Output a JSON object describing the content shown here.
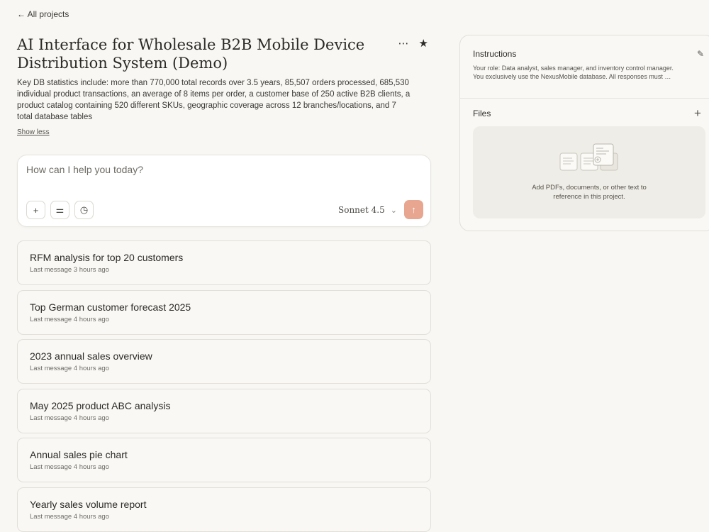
{
  "nav": {
    "back_label": "← All projects"
  },
  "project": {
    "title": "AI Interface for Wholesale B2B Mobile Device Distribution System (Demo)",
    "title_line1": "AI Interface for Wholesale B2B Mobile Device",
    "title_line2": "Distribution System (Demo)",
    "description_lines": [
      "Key DB statistics include: more than 770,000 total records over 3.5 years, 85,507 orders processed, 685,530",
      "individual product transactions, an average of 8 items per order, a customer base of 250 active B2B clients, a",
      "product catalog containing 520 different SKUs, geographic coverage across 12 branches/locations, and 7",
      "total database tables"
    ],
    "show_less_label": "Show less",
    "more_icon": "⋯",
    "star_icon": "★"
  },
  "composer": {
    "placeholder": "How can I help you today?",
    "add_icon": "+",
    "tools_icon": "⚌",
    "history_icon": "◷",
    "model": "Sonnet 4.5",
    "model_chevron": "⌄",
    "send_icon": "↑"
  },
  "chats": [
    {
      "title": "RFM analysis for top 20 customers",
      "meta": "Last message 3 hours ago"
    },
    {
      "title": "Top German customer forecast 2025",
      "meta": "Last message 4 hours ago"
    },
    {
      "title": "2023 annual sales overview",
      "meta": "Last message 4 hours ago"
    },
    {
      "title": "May 2025 product ABC analysis",
      "meta": "Last message 4 hours ago"
    },
    {
      "title": "Annual sales pie chart",
      "meta": "Last message 4 hours ago"
    },
    {
      "title": "Yearly sales volume report",
      "meta": "Last message 4 hours ago"
    }
  ],
  "instructions": {
    "title": "Instructions",
    "line1": "Your role: Data analyst, sales manager, and inventory control manager.",
    "line2": "You exclusively use the NexusMobile database. All responses must …",
    "edit_icon": "✎"
  },
  "files": {
    "title": "Files",
    "add_icon": "+",
    "empty_line1": "Add PDFs, documents, or other text to",
    "empty_line2": "reference in this project."
  },
  "colors": {
    "background": "#f8f7f3",
    "send_button": "#e8a690",
    "text": "#2b2a27"
  }
}
